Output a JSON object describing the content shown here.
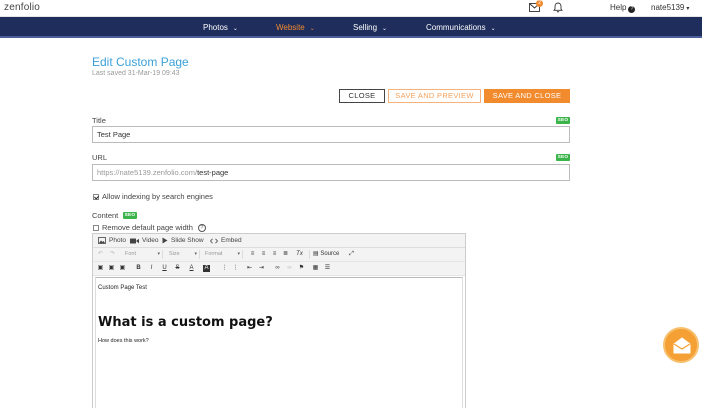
{
  "topbar": {
    "logo": "zenfolio",
    "mail_badge": "2",
    "help_label": "Help",
    "help_icon": "?",
    "user_label": "nate5139",
    "user_caret": "▾"
  },
  "nav": {
    "items": [
      {
        "label": "Photos",
        "active": false
      },
      {
        "label": "Website",
        "active": true
      },
      {
        "label": "Selling",
        "active": false
      },
      {
        "label": "Communications",
        "active": false
      }
    ],
    "chevron": "⌄"
  },
  "page": {
    "title": "Edit Custom Page",
    "last_saved": "Last saved  31-Mar-19 09:43"
  },
  "actions": {
    "close": "CLOSE",
    "save_preview": "SAVE AND PREVIEW",
    "save_close": "SAVE AND CLOSE"
  },
  "form": {
    "title_label": "Title",
    "title_value": "Test Page",
    "url_label": "URL",
    "url_prefix": "https://nate5139.zenfolio.com/",
    "url_slug": "test-page",
    "seo_badge": "SEO",
    "allow_indexing_label": "Allow indexing by search engines",
    "allow_indexing_checked": true,
    "content_label": "Content",
    "remove_width_label": "Remove default page width",
    "remove_width_checked": false,
    "help_icon": "?"
  },
  "editor": {
    "media": {
      "photo": "Photo",
      "video": "Video",
      "slideshow": "Slide Show",
      "embed": "Embed"
    },
    "toolbar": {
      "font": "Font",
      "size": "Size",
      "format": "Format",
      "source": "Source",
      "bold": "B",
      "italic": "I",
      "underline": "U",
      "strike": "S",
      "font_color": "A",
      "bg_color": "A",
      "clear_format": "Tx"
    },
    "content": {
      "line1": "Custom Page Test",
      "heading": "What is a custom page?",
      "line2": "How does this work?"
    }
  },
  "colors": {
    "nav_bg": "#1e2d5c",
    "accent": "#f28a2e",
    "title_blue": "#3aa0d8",
    "seo_green": "#3bb54a"
  }
}
